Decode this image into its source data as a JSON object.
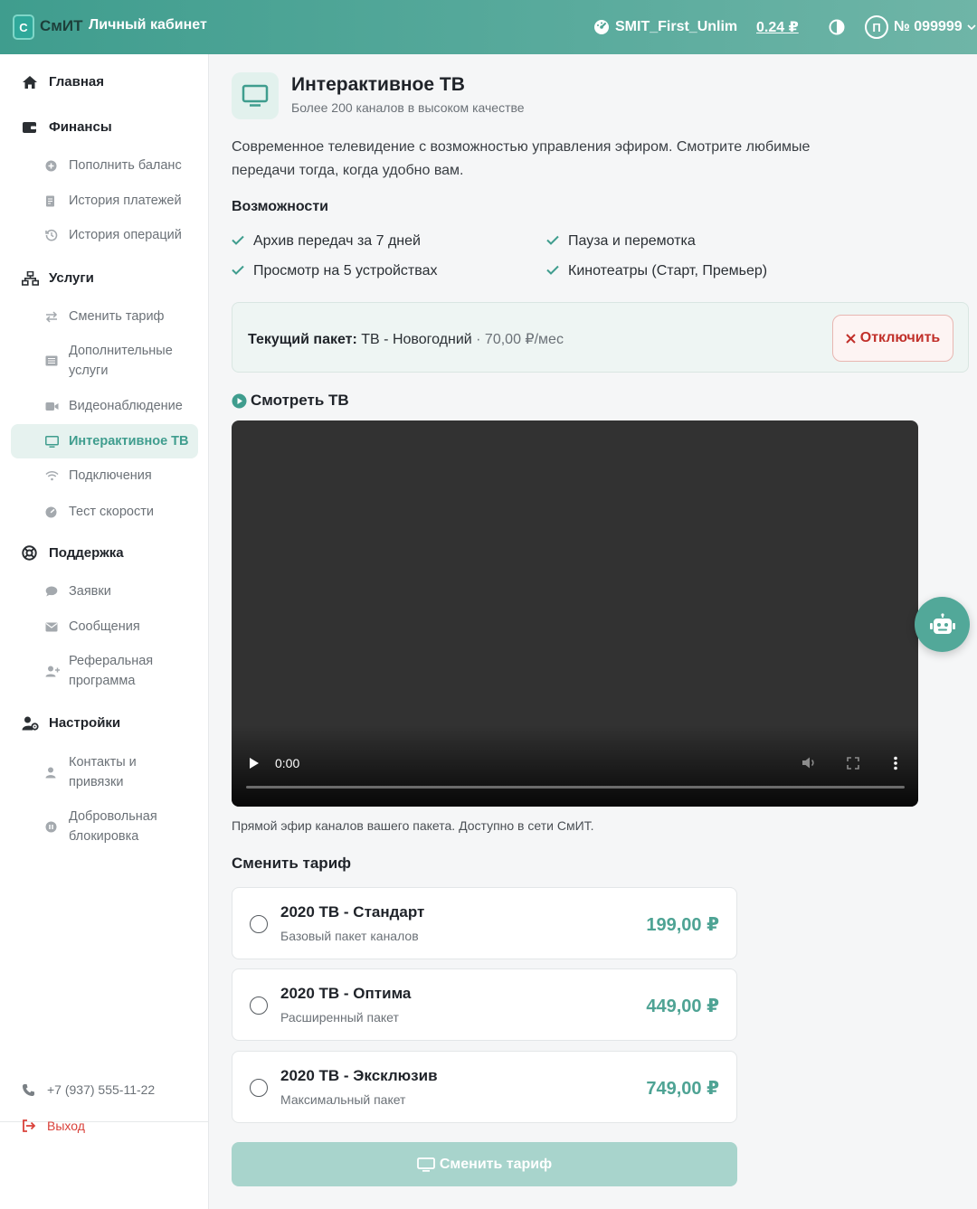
{
  "header": {
    "logo_letter": "С",
    "brand": "СмИТ",
    "subtitle": "Личный кабинет",
    "account_name": "SMIT_First_Unlim",
    "balance": "0.24 ₽",
    "avatar_letter": "П",
    "account_number": "№ 099999"
  },
  "sidebar": {
    "sections": {
      "home": "Главная",
      "finance": "Финансы",
      "services": "Услуги",
      "support": "Поддержка",
      "settings": "Настройки"
    },
    "items": {
      "topup": "Пополнить баланс",
      "payments": "История платежей",
      "operations": "История операций",
      "change_tariff": "Сменить тариф",
      "extra_services": "Дополнительные услуги",
      "video_surveillance": "Видеонаблюдение",
      "interactive_tv": "Интерактивное ТВ",
      "connections": "Подключения",
      "speed_test": "Тест скорости",
      "tickets": "Заявки",
      "messages": "Сообщения",
      "referral": "Реферальная программа",
      "contacts": "Контакты и привязки",
      "voluntary_block": "Добровольная блокировка"
    },
    "phone": "+7 (937) 555-11-22",
    "logout": "Выход"
  },
  "service": {
    "title": "Интерактивное ТВ",
    "subtitle": "Более 200 каналов в высоком качестве",
    "description": "Современное телевидение с возможностью управления эфиром. Смотрите любимые передачи тогда, когда удобно вам.",
    "features_title": "Возможности",
    "features": [
      "Архив передач за 7 дней",
      "Пауза и перемотка",
      "Просмотр на 5 устройствах",
      "Кинотеатры (Старт, Премьер)"
    ]
  },
  "current_package": {
    "label": "Текущий пакет:",
    "name": "ТВ - Новогодний",
    "price": "· 70,00 ₽/мес",
    "disable_label": "Отключить"
  },
  "watch": {
    "title": "Смотреть ТВ",
    "time": "0:00",
    "progress": 0,
    "note": "Прямой эфир каналов вашего пакета. Доступно в сети СмИТ."
  },
  "change_tariff": {
    "title": "Сменить тариф",
    "options": [
      {
        "name": "2020 ТВ - Стандарт",
        "desc": "Базовый пакет каналов",
        "price": "199,00 ₽"
      },
      {
        "name": "2020 ТВ - Оптима",
        "desc": "Расширенный пакет",
        "price": "449,00 ₽"
      },
      {
        "name": "2020 ТВ - Эксклюзив",
        "desc": "Максимальный пакет",
        "price": "749,00 ₽"
      }
    ],
    "button_label": "Сменить тариф"
  },
  "colors": {
    "accent": "#3f9d8e",
    "danger": "#c1302a"
  }
}
